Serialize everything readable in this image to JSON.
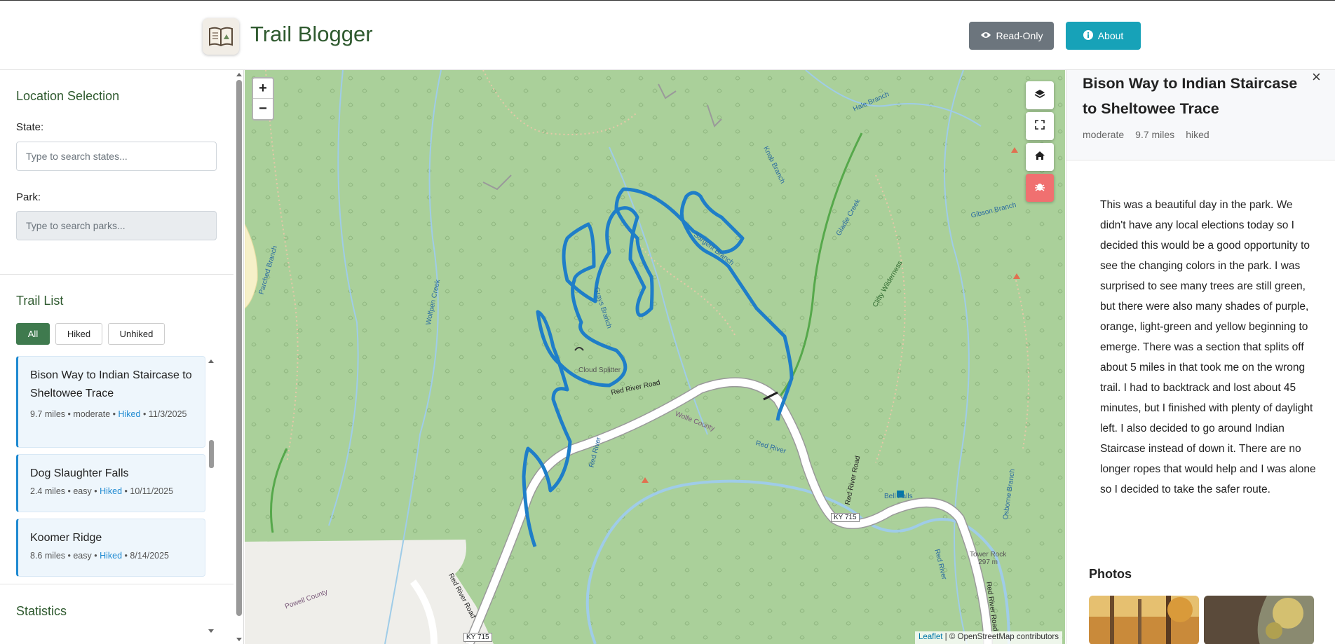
{
  "header": {
    "app_title": "Trail Blogger",
    "read_only_label": "Read-Only",
    "about_label": "About",
    "colors": {
      "brand": "#2f5a2f",
      "read_only": "#6c757d",
      "about": "#17a2b8"
    }
  },
  "sidebar": {
    "location_title": "Location Selection",
    "state_label": "State:",
    "state_placeholder": "Type to search states...",
    "park_label": "Park:",
    "park_placeholder": "Type to search parks...",
    "trail_list_title": "Trail List",
    "filters": [
      "All",
      "Hiked",
      "Unhiked"
    ],
    "active_filter": "All",
    "trails": [
      {
        "name": "Bison Way to Indian Staircase to Sheltowee Trace",
        "distance": "9.7 miles",
        "difficulty": "moderate",
        "status": "Hiked",
        "date": "11/3/2025"
      },
      {
        "name": "Dog Slaughter Falls",
        "distance": "2.4 miles",
        "difficulty": "easy",
        "status": "Hiked",
        "date": "10/11/2025"
      },
      {
        "name": "Koomer Ridge",
        "distance": "8.6 miles",
        "difficulty": "easy",
        "status": "Hiked",
        "date": "8/14/2025"
      }
    ],
    "statistics_title": "Statistics"
  },
  "map": {
    "zoom_in": "+",
    "zoom_out": "−",
    "controls": [
      "layers-icon",
      "fullscreen-icon",
      "home-icon",
      "bug-icon"
    ],
    "labels": {
      "red_river_road": "Red River Road",
      "red_river": "Red River",
      "red_river_2": "Red River",
      "red_river_3": "Red River",
      "red_river_rd_sw": "Red River Road",
      "red_river_rd_se": "Red River Road",
      "red_river_rd_e": "Red River Road",
      "cloud_splitter": "Cloud Splitter",
      "ky715_a": "KY 715",
      "ky715_b": "KY 715",
      "wolfe_county": "Wolfe County",
      "powell_county": "Powell County",
      "bell_falls": "Bell Falls",
      "tower_rock": "Tower Rock",
      "tower_rock_elev": "297 m",
      "clifty_wilderness": "Clifty Wilderness",
      "sargent_branch": "Sargent Branch",
      "gibson_branch": "Gibson Branch",
      "hale_branch": "Hale Branch",
      "gladie_creek": "Gladie Creek",
      "knob_branch": "Knob Branch",
      "wolfpen_creek": "Wolfpen Creek",
      "osborne_branch": "Osborne Branch",
      "grays_branch": "Grays Branch",
      "parched_branch": "Parched Branch"
    },
    "attribution_leaflet": "Leaflet",
    "attribution_rest": "| © OpenStreetMap contributors",
    "route_color": "#1f8ad1"
  },
  "details": {
    "title": "Bison Way to Indian Staircase to Sheltowee Trace",
    "difficulty": "moderate",
    "distance": "9.7 miles",
    "status": "hiked",
    "close": "×",
    "description": "This was a beautiful day in the park. We didn't have any local elections today so I decided this would be a good opportunity to see the changing colors in the park. I was surprised to see many trees are still green, but there were also many shades of purple, orange, light-green and yellow beginning to emerge. There was a section that splits off about 5 miles in that took me on the wrong trail. I had to backtrack and lost about 45 minutes, but I finished with plenty of daylight left. I also decided to go around Indian Staircase instead of down it. There are no longer ropes that would help and I was alone so I decided to take the safer route.",
    "photos_title": "Photos"
  }
}
